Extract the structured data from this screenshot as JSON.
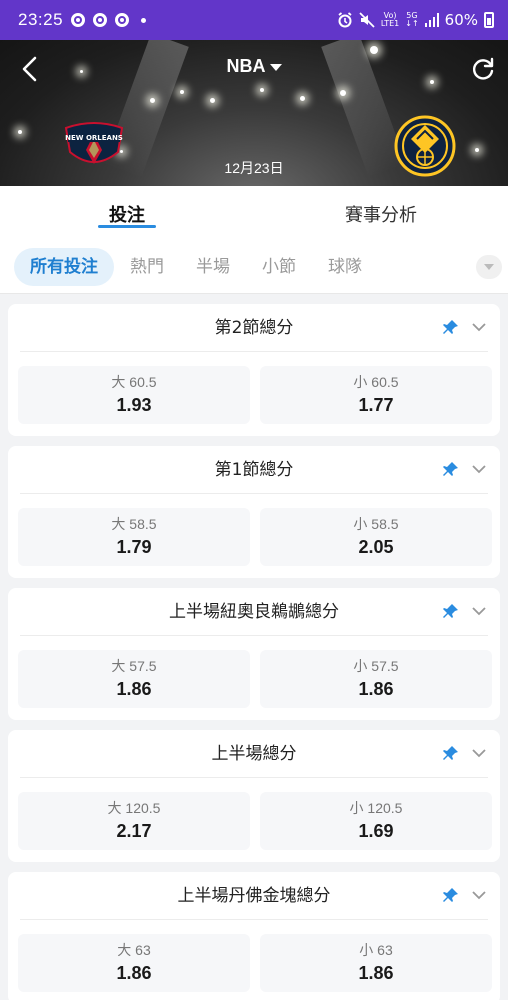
{
  "status_bar": {
    "time": "23:25",
    "battery": "60%",
    "net_top": "Vo)",
    "net_bottom": "LTE1",
    "data_top": "5G",
    "data_bottom": "↓↑"
  },
  "header": {
    "league": "NBA",
    "date": "12月23日",
    "home_team_logo_text": "NEW ORLEANS"
  },
  "main_tabs": [
    {
      "label": "投注",
      "active": true
    },
    {
      "label": "賽事分析",
      "active": false
    }
  ],
  "sub_tabs": [
    {
      "label": "所有投注",
      "active": true
    },
    {
      "label": "熱門",
      "active": false
    },
    {
      "label": "半場",
      "active": false
    },
    {
      "label": "小節",
      "active": false
    },
    {
      "label": "球隊",
      "active": false
    }
  ],
  "markets": [
    {
      "title": "第2節總分",
      "over": {
        "label": "大 60.5",
        "odds": "1.93"
      },
      "under": {
        "label": "小 60.5",
        "odds": "1.77"
      }
    },
    {
      "title": "第1節總分",
      "over": {
        "label": "大 58.5",
        "odds": "1.79"
      },
      "under": {
        "label": "小 58.5",
        "odds": "2.05"
      }
    },
    {
      "title": "上半場紐奧良鵜鶘總分",
      "over": {
        "label": "大 57.5",
        "odds": "1.86"
      },
      "under": {
        "label": "小 57.5",
        "odds": "1.86"
      }
    },
    {
      "title": "上半場總分",
      "over": {
        "label": "大 120.5",
        "odds": "2.17"
      },
      "under": {
        "label": "小 120.5",
        "odds": "1.69"
      }
    },
    {
      "title": "上半場丹佛金塊總分",
      "over": {
        "label": "大 63",
        "odds": "1.86"
      },
      "under": {
        "label": "小 63",
        "odds": "1.86"
      }
    }
  ],
  "colors": {
    "status_bar": "#6236c9",
    "accent": "#2a8ce0",
    "chip_active_bg": "#e4f1fb"
  }
}
